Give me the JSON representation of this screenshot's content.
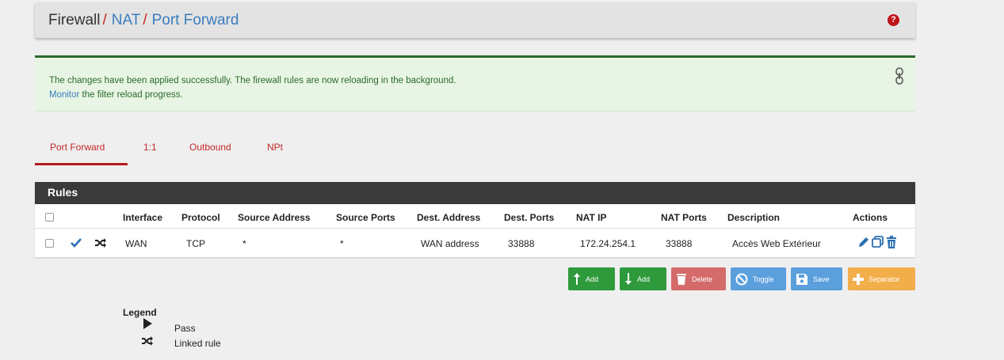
{
  "breadcrumb": {
    "root": "Firewall",
    "separator": "/",
    "level1": "NAT",
    "level2": "Port Forward"
  },
  "alert": {
    "message": "The changes have been applied successfully. The firewall rules are now reloading in the background.",
    "monitor_link": "Monitor",
    "monitor_suffix": " the filter reload progress."
  },
  "tabs": [
    {
      "label": "Port Forward",
      "active": true
    },
    {
      "label": "1:1",
      "active": false
    },
    {
      "label": "Outbound",
      "active": false
    },
    {
      "label": "NPt",
      "active": false
    }
  ],
  "panel": {
    "title": "Rules"
  },
  "table": {
    "headers": [
      "Interface",
      "Protocol",
      "Source Address",
      "Source Ports",
      "Dest. Address",
      "Dest. Ports",
      "NAT IP",
      "NAT Ports",
      "Description",
      "Actions"
    ],
    "rows": [
      {
        "interface": "WAN",
        "protocol": "TCP",
        "source_address": "*",
        "source_ports": "*",
        "dest_address": "WAN address",
        "dest_ports": "33888",
        "nat_ip": "172.24.254.1",
        "nat_ports": "33888",
        "description": "Accès Web Extérieur"
      }
    ]
  },
  "buttons": {
    "add_top": "Add",
    "add_bottom": "Add",
    "delete": "Delete",
    "toggle": "Toggle",
    "save": "Save",
    "separator": "Separator"
  },
  "legend": {
    "title": "Legend",
    "pass": "Pass",
    "linked": "Linked rule"
  },
  "colors": {
    "accent_red": "#c62828",
    "link_blue": "#3a7dbf",
    "success_green": "#2e9a3c",
    "danger": "#d56a6a",
    "info": "#5b9fdd",
    "warning": "#f2ae4a"
  },
  "icons": [
    "help-icon",
    "close-icon",
    "check-icon",
    "random-icon",
    "pencil-icon",
    "copy-icon",
    "trash-icon",
    "add-top-icon",
    "add-bottom-icon",
    "ban-icon",
    "save-icon",
    "plus-icon",
    "play-icon"
  ]
}
